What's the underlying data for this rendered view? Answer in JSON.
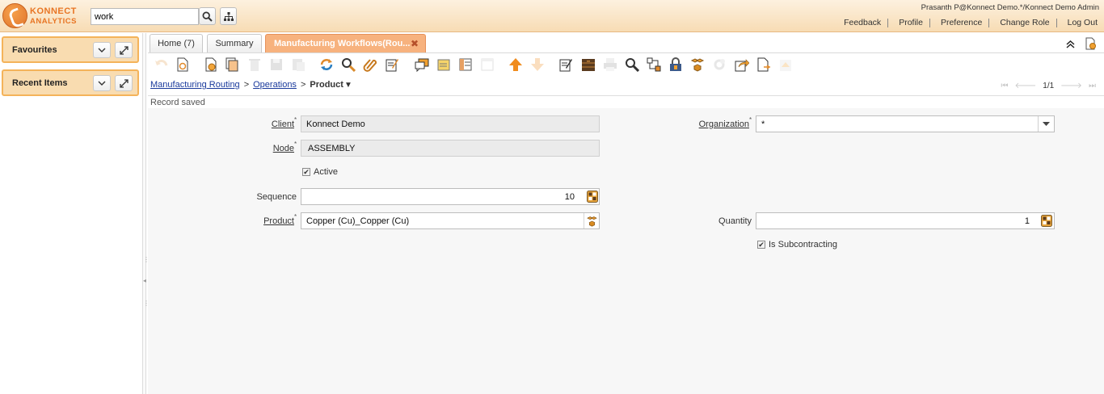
{
  "header": {
    "logo_line1": "KONNECT",
    "logo_line2": "ANALYTICS",
    "search_value": "work",
    "user_info": "Prasanth P@Konnect Demo.*/Konnect Demo Admin",
    "links": [
      "Feedback",
      "Profile",
      "Preference",
      "Change Role",
      "Log Out"
    ]
  },
  "left_panel": {
    "favourites": "Favourites",
    "recent_items": "Recent Items"
  },
  "tabs": [
    {
      "label": "Home (7)"
    },
    {
      "label": "Summary"
    },
    {
      "label": "Manufacturing Workflows(Rou..."
    }
  ],
  "breadcrumb": {
    "item1": "Manufacturing Routing",
    "item2": "Operations",
    "separator": ">",
    "current": "Product",
    "record_nav": "1/1"
  },
  "status": "Record saved",
  "form": {
    "client_label": "Client",
    "client_value": "Konnect Demo",
    "organization_label": "Organization",
    "organization_value": "*",
    "node_label": "Node",
    "node_value": "ASSEMBLY",
    "active_label": "Active",
    "sequence_label": "Sequence",
    "sequence_value": "10",
    "product_label": "Product",
    "product_value": "Copper (Cu)_Copper (Cu)",
    "quantity_label": "Quantity",
    "quantity_value": "1",
    "subcontracting_label": "Is Subcontracting",
    "required_mark": "*"
  },
  "colors": {
    "accent": "#f7b27e",
    "header_bg": "#f9dcb0",
    "link": "#1a3a9c"
  }
}
